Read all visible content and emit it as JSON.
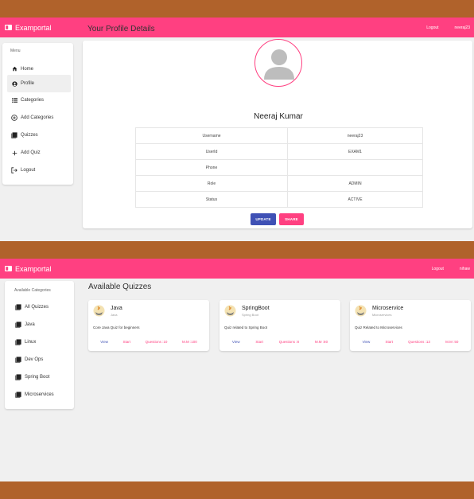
{
  "profile_screen": {
    "appbar": {
      "brand": "Examportal",
      "logout": "Logout",
      "username": "neeraj23"
    },
    "sidebar": {
      "title": "Menu",
      "items": [
        {
          "label": "Home",
          "icon": "home-icon",
          "active": false
        },
        {
          "label": "Profile",
          "icon": "account-circle-icon",
          "active": true
        },
        {
          "label": "Categories",
          "icon": "list-icon",
          "active": false
        },
        {
          "label": "Add Categories",
          "icon": "add-circle-icon",
          "active": false
        },
        {
          "label": "Quizzes",
          "icon": "book-icon",
          "active": false
        },
        {
          "label": "Add Quiz",
          "icon": "plus-icon",
          "active": false
        },
        {
          "label": "Logout",
          "icon": "logout-icon",
          "active": false
        }
      ]
    },
    "page_title": "Your Profile Details",
    "full_name": "Neeraj Kumar",
    "details": [
      {
        "key": "Username",
        "value": "neeraj23"
      },
      {
        "key": "UserId",
        "value": "EXAM1"
      },
      {
        "key": "Phone",
        "value": ""
      },
      {
        "key": "Role",
        "value": "ADMIN"
      },
      {
        "key": "Status",
        "value": "ACTIVE"
      }
    ],
    "buttons": {
      "update": "UPDATE",
      "share": "SHARE"
    }
  },
  "quizzes_screen": {
    "appbar": {
      "brand": "Examportal",
      "logout": "Logout",
      "username": "nihaw"
    },
    "sidebar": {
      "title": "Available Categories",
      "items": [
        {
          "label": "All Quizzes",
          "icon": "book-icon"
        },
        {
          "label": "Java",
          "icon": "book-icon"
        },
        {
          "label": "Linux",
          "icon": "book-icon"
        },
        {
          "label": "Dev Ops",
          "icon": "book-icon"
        },
        {
          "label": "Spring Boot",
          "icon": "book-icon"
        },
        {
          "label": "Microservices",
          "icon": "book-icon"
        }
      ]
    },
    "page_title": "Available Quizzes",
    "quizzes": [
      {
        "title": "Java",
        "category": "Java",
        "description": "Core Java Quiz for beginners",
        "view": "View",
        "start": "Start",
        "questions": "Questions :10",
        "max_marks": "M.M :100"
      },
      {
        "title": "SpringBoot",
        "category": "Spring Boot",
        "description": "Quiz related to Spring Boot",
        "view": "View",
        "start": "Start",
        "questions": "Questions :8",
        "max_marks": "M.M :80"
      },
      {
        "title": "Microservice",
        "category": "Microservices",
        "description": "Quiz Related to Microservices",
        "view": "View",
        "start": "Start",
        "questions": "Questions :13",
        "max_marks": "M.M :50"
      }
    ]
  },
  "colors": {
    "primary_pink": "#ff4081",
    "primary_indigo": "#3f51b5",
    "backdrop": "#b0622b"
  }
}
